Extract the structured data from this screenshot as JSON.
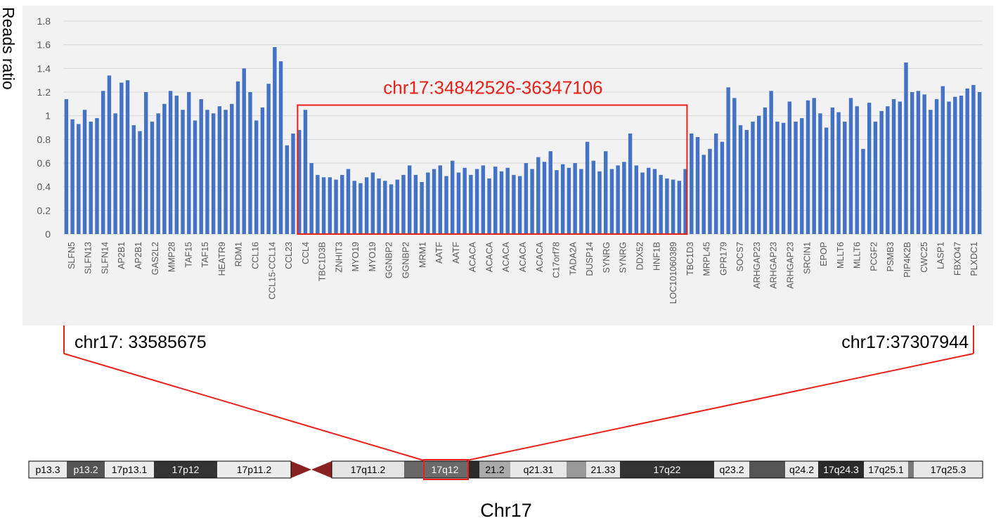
{
  "chart_data": {
    "type": "bar",
    "ylabel": "Reads ratio",
    "ylim": [
      0,
      1.8
    ],
    "yticks": [
      "0",
      "0.2",
      "0.4",
      "0.6",
      "0.8",
      "1",
      "1.2",
      "1.4",
      "1.6",
      "1.8"
    ],
    "grid": true,
    "bar_color": "#4472c4",
    "gene_labels": [
      "SLFN5",
      "SLFN13",
      "SLFN14",
      "AP2B1",
      "AP2B1",
      "GAS2L2",
      "MMP28",
      "TAF15",
      "TAF15",
      "HEATR9",
      "RDM1",
      "CCL16",
      "CCL15-CCL14",
      "CCL23",
      "CCL4",
      "TBC1D3B",
      "ZNHIT3",
      "MYO19",
      "MYO19",
      "GGNBP2",
      "GGNBP2",
      "MRM1",
      "AATF",
      "AATF",
      "ACACA",
      "ACACA",
      "ACACA",
      "ACACA",
      "ACACA",
      "C17orf78",
      "TADA2A",
      "DUSP14",
      "SYNRG",
      "SYNRG",
      "DDX52",
      "HNF1B",
      "LOC101060389",
      "TBC1D3",
      "MRPL45",
      "GPR179",
      "SOCS7",
      "ARHGAP23",
      "ARHGAP23",
      "ARHGAP23",
      "SRCIN1",
      "EPOP",
      "MLLT6",
      "MLLT6",
      "PCGF2",
      "PSMB3",
      "PIP4K2B",
      "CWC25",
      "LASP1",
      "FBXO47",
      "PLXDC1"
    ],
    "series": [
      {
        "values": [
          1.14,
          0.97,
          0.93,
          1.05,
          0.95,
          0.98,
          1.21,
          1.34,
          1.02,
          1.28,
          1.3,
          0.92,
          0.87,
          1.2,
          0.95,
          1.02,
          1.1,
          1.21,
          1.17,
          1.05,
          1.2,
          0.96,
          1.14,
          1.05,
          1.02,
          1.08,
          1.05,
          1.1,
          1.29,
          1.4,
          1.2,
          0.96,
          1.07,
          1.27,
          1.58,
          1.46,
          0.75,
          0.85,
          0.88,
          1.05,
          0.6,
          0.5,
          0.48,
          0.48,
          0.46,
          0.5,
          0.55,
          0.45,
          0.43,
          0.48,
          0.52,
          0.47,
          0.45,
          0.42,
          0.46,
          0.5,
          0.58,
          0.5,
          0.44,
          0.52,
          0.55,
          0.58,
          0.49,
          0.62,
          0.52,
          0.56,
          0.5,
          0.55,
          0.58,
          0.47,
          0.57,
          0.53,
          0.56,
          0.5,
          0.49,
          0.6,
          0.55,
          0.65,
          0.61,
          0.7,
          0.54,
          0.59,
          0.56,
          0.6,
          0.55,
          0.78,
          0.62,
          0.53,
          0.7,
          0.55,
          0.58,
          0.61,
          0.85,
          0.58,
          0.52,
          0.56,
          0.55,
          0.5,
          0.47,
          0.46,
          0.45,
          0.55,
          0.85,
          0.82,
          0.67,
          0.72,
          0.85,
          0.78,
          1.24,
          1.15,
          0.92,
          0.88,
          0.95,
          1.0,
          1.07,
          1.21,
          0.95,
          0.94,
          1.12,
          0.95,
          0.98,
          1.13,
          1.15,
          1.02,
          0.9,
          1.07,
          1.03,
          0.95,
          1.15,
          1.08,
          0.72,
          1.11,
          0.95,
          1.04,
          1.08,
          1.14,
          1.12,
          1.45,
          1.2,
          1.21,
          1.18,
          1.05,
          1.14,
          1.25,
          1.12,
          1.16,
          1.17,
          1.23,
          1.26,
          1.2
        ]
      }
    ],
    "highlight_region": {
      "label": "chr17:34842526-36347106",
      "start_index": 38,
      "end_index": 101,
      "color": "#e8211b"
    },
    "range_start_label": "chr17: 33585675",
    "range_end_label": "chr17:37307944"
  },
  "ideogram": {
    "title": "Chr17",
    "bands": [
      {
        "label": "p13.3",
        "fill": "#ececec",
        "text": "#000000"
      },
      {
        "label": "p13.2",
        "fill": "#555555",
        "text": "#ffffff"
      },
      {
        "label": "17p13.1",
        "fill": "#ececec",
        "text": "#000000"
      },
      {
        "label": "17p12",
        "fill": "#333333",
        "text": "#ffffff"
      },
      {
        "label": "17p11.2",
        "fill": "#ececec",
        "text": "#000000"
      },
      {
        "label": "",
        "fill": "#8b2222",
        "text": "#ffffff",
        "centromere": true
      },
      {
        "label": "17q11.2",
        "fill": "#e4e4e4",
        "text": "#000000"
      },
      {
        "label": "",
        "fill": "#666666",
        "text": "#ffffff"
      },
      {
        "label": "17q12",
        "fill": "#6a6a6a",
        "text": "#ffffff"
      },
      {
        "label": "",
        "fill": "#2a2a2a",
        "text": "#ffffff"
      },
      {
        "label": "21.2",
        "fill": "#aaaaaa",
        "text": "#000000"
      },
      {
        "label": "q21.31",
        "fill": "#e8e8e8",
        "text": "#000000"
      },
      {
        "label": "",
        "fill": "#999999",
        "text": "#000000"
      },
      {
        "label": "21.33",
        "fill": "#e8e8e8",
        "text": "#000000"
      },
      {
        "label": "17q22",
        "fill": "#333333",
        "text": "#ffffff"
      },
      {
        "label": "q23.2",
        "fill": "#ececec",
        "text": "#000000"
      },
      {
        "label": "",
        "fill": "#555555",
        "text": "#ffffff"
      },
      {
        "label": "q24.2",
        "fill": "#e8e8e8",
        "text": "#000000"
      },
      {
        "label": "17q24.3",
        "fill": "#2a2a2a",
        "text": "#ffffff"
      },
      {
        "label": "17q25.1",
        "fill": "#e8e8e8",
        "text": "#000000"
      },
      {
        "label": "",
        "fill": "#7a7a7a",
        "text": "#ffffff"
      },
      {
        "label": "17q25.3",
        "fill": "#e8e8e8",
        "text": "#000000"
      }
    ],
    "highlight_band": "17q12",
    "highlight_color": "#e8211b"
  }
}
